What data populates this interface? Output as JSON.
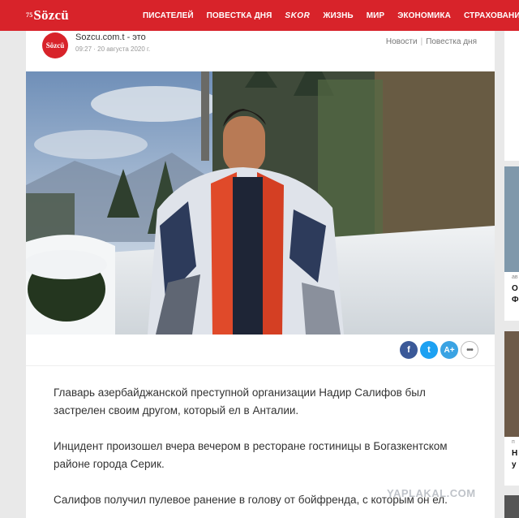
{
  "topnav": {
    "logo_year": "75",
    "logo_text": "Sözcü",
    "items": [
      "ПИСАТЕЛЕЙ",
      "ПОВЕСТКА ДНЯ",
      "SKOR",
      "ЖИЗНЬ",
      "МИР",
      "ЭКОНОМИКА",
      "СТРАХОВАНИЕ"
    ]
  },
  "source": {
    "avatar_text": "Sözcü",
    "name": "Sozcu.com.t - это",
    "time": "09:27 · 20 августа 2020 г."
  },
  "categories": [
    "Новости",
    "Повестка дня"
  ],
  "share": {
    "facebook": "f",
    "twitter": "t",
    "font_size": "A+",
    "more": "•••"
  },
  "article": {
    "paragraphs": [
      "Главарь азербайджанской преступной организации Надир Салифов был застрелен своим другом, который ел в Анталии.",
      "Инцидент произошел вчера вечером в ресторане гостиницы в Богазкентском районе города Серик.",
      "Салифов получил пулевое ранение в голову от бойфренда, с которым он ел."
    ]
  },
  "sidebar": {
    "letters_1": [
      "ав",
      "О",
      "Ф"
    ],
    "letters_2": [
      "п",
      "Н",
      "у"
    ]
  },
  "watermark": "YAPLAKAL.COM",
  "colors": {
    "brand": "#d8232a",
    "facebook": "#3b5998",
    "twitter": "#1da1f2"
  }
}
